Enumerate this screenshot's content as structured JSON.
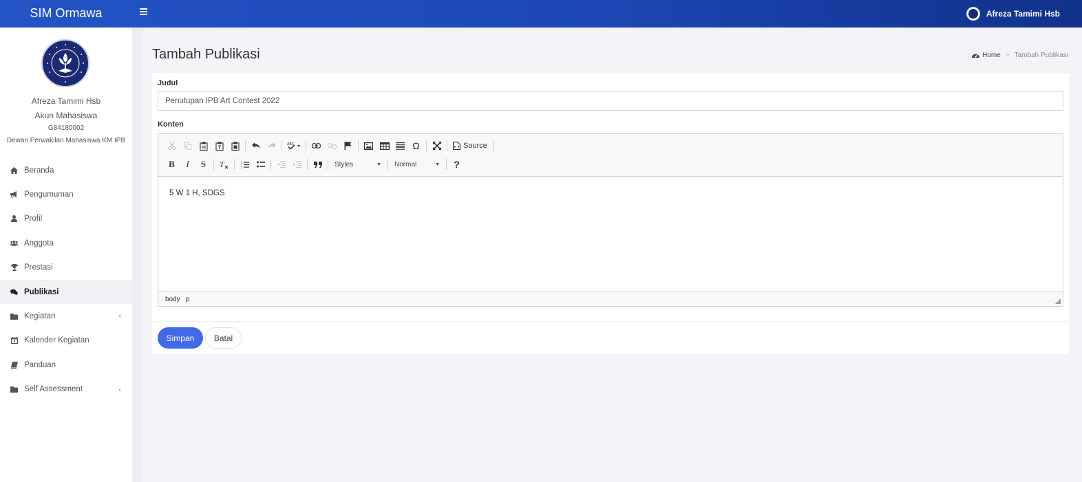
{
  "app": {
    "brand": "SIM Ormawa"
  },
  "header": {
    "user_name": "Afreza Tamimi Hsb",
    "icons": [
      "menu-icon",
      "user-avatar-icon"
    ]
  },
  "profile": {
    "name": "Afreza Tamimi Hsb",
    "role": "Akun Mahasiswa",
    "nim": "G84180002",
    "organization": "Dewan Perwakilan Mahasiswa KM IPB"
  },
  "sidebar": {
    "items": [
      {
        "label": "Beranda",
        "icon": "home-icon"
      },
      {
        "label": "Pengumuman",
        "icon": "bullhorn-icon"
      },
      {
        "label": "Profil",
        "icon": "user-icon"
      },
      {
        "label": "Anggota",
        "icon": "users-icon"
      },
      {
        "label": "Prestasi",
        "icon": "trophy-icon"
      },
      {
        "label": "Publikasi",
        "icon": "comments-icon",
        "active": true
      },
      {
        "label": "Kegiatan",
        "icon": "folder-icon",
        "has_submenu": true
      },
      {
        "label": "Kalender Kegiatan",
        "icon": "calendar-icon"
      },
      {
        "label": "Panduan",
        "icon": "book-icon"
      },
      {
        "label": "Self Assessment",
        "icon": "folder-icon",
        "has_submenu": true
      }
    ],
    "chevron": "‹"
  },
  "page": {
    "title": "Tambah Publikasi"
  },
  "breadcrumb": {
    "home": "Home",
    "separator": ">",
    "current": "Tambah Publikasi"
  },
  "form": {
    "judul_label": "Judul",
    "judul_value": "Penutupan IPB Art Contest 2022",
    "konten_label": "Konten",
    "konten_value": "5 W 1 H, SDGS",
    "submit_label": "Simpan",
    "cancel_label": "Batal"
  },
  "editor": {
    "source_label": "Source",
    "styles_label": "Styles",
    "format_label": "Normal",
    "help_label": "?",
    "path": [
      "body",
      "p"
    ],
    "toolbar_row1": [
      "cut",
      "copy",
      "paste",
      "paste-text",
      "paste-word",
      "undo",
      "redo",
      "spellcheck",
      "link",
      "unlink",
      "anchor",
      "image",
      "table",
      "horizontal-rule",
      "special-char",
      "maximize",
      "source"
    ],
    "toolbar_row2": [
      "bold",
      "italic",
      "strike",
      "remove-format",
      "numbered-list",
      "bulleted-list",
      "outdent",
      "indent",
      "blockquote",
      "styles",
      "format",
      "about"
    ]
  },
  "colors": {
    "header_start": "#2454c6",
    "header_end": "#11318a",
    "primary_button": "#4469e8",
    "logo_navy": "#1b2a73"
  }
}
